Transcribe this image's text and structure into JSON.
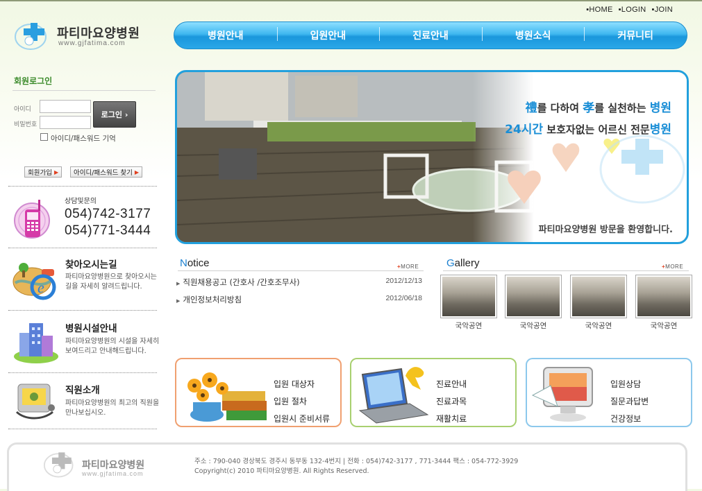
{
  "util_links": [
    "HOME",
    "LOGIN",
    "JOIN"
  ],
  "logo": {
    "name": "파티마요양병원",
    "url": "www.gjfatima.com"
  },
  "nav": [
    "병원안내",
    "입원안내",
    "진료안내",
    "병원소식",
    "커뮤니티"
  ],
  "login": {
    "title": "회원로그인",
    "id_label": "아이디",
    "pw_label": "비밀번호",
    "button": "로그인",
    "remember": "아이디/패스워드 기억",
    "join": "회원가입",
    "find": "아이디/패스워드 찾기"
  },
  "contact": {
    "label": "상담및문의",
    "phone1": "054)742-3177",
    "phone2": "054)771-3444"
  },
  "side_menu": [
    {
      "title": "찾아오시는길",
      "desc": "파티마요양병원으로 찾아오시는길을 자세히 알려드립니다."
    },
    {
      "title": "병원시설안내",
      "desc": "파티마요양병원의 시설을 자세히 보여드리고 안내해드립니다."
    },
    {
      "title": "직원소개",
      "desc": "파티마요양병원의 최고의 직원을 만나보십시오."
    }
  ],
  "banner": {
    "l1_a": "禮",
    "l1_b": "를 다하여 ",
    "l1_c": "孝",
    "l1_d": "를 실천하는 ",
    "l1_e": "병원",
    "l2_a": "24시간",
    "l2_b": " 보호자없는 어르신 전문",
    "l2_c": "병원",
    "welcome": "파티마요양병원 방문을 환영합니다."
  },
  "notice": {
    "title_first": "N",
    "title_rest": "otice",
    "more": "MORE",
    "items": [
      {
        "title": "직원채용공고 (간호사 /간호조무사)",
        "date": "2012/12/13"
      },
      {
        "title": "개인정보처리방침",
        "date": "2012/06/18"
      }
    ]
  },
  "gallery": {
    "title_first": "G",
    "title_rest": "allery",
    "more": "MORE",
    "items": [
      "국악공연",
      "국악공연",
      "국악공연",
      "국악공연"
    ]
  },
  "quick": [
    {
      "links": [
        "입원 대상자",
        "입원 절차",
        "입원시 준비서류"
      ],
      "color": "#f0a070"
    },
    {
      "links": [
        "진료안내",
        "진료과목",
        "재활치료"
      ],
      "color": "#a8d070"
    },
    {
      "links": [
        "입원상담",
        "질문과답변",
        "건강정보"
      ],
      "color": "#8cc8ec"
    }
  ],
  "footer": {
    "name": "파티마요양병원",
    "url": "www.gjfatima.com",
    "address": "주소 : 790-040 경상북도 경주시 동부동 132-4번지   |   전화 : 054)742-3177 , 771-3444   팩스 : 054-772-3929",
    "copyright": "Copyright(c) 2010 파티마요양병원. All Rights Reserved."
  },
  "colors": {
    "accent_blue": "#22a0dd",
    "green_title": "#3a8a2a"
  }
}
